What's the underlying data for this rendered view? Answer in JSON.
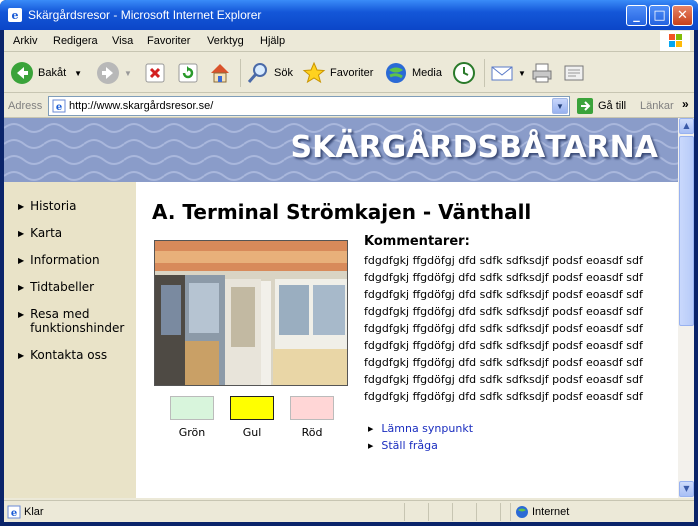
{
  "window": {
    "title": "Skärgårdsresor - Microsoft Internet Explorer"
  },
  "menu": [
    "Arkiv",
    "Redigera",
    "Visa",
    "Favoriter",
    "Verktyg",
    "Hjälp"
  ],
  "toolbar": {
    "back": "Bakåt",
    "search": "Sök",
    "favorites": "Favoriter",
    "media": "Media"
  },
  "address": {
    "label": "Adress",
    "url": "http://www.skargårdsresor.se/",
    "go": "Gå till",
    "links": "Länkar"
  },
  "site": {
    "banner": "SKÄRGÅRDSBÅTARNA",
    "nav": [
      "Historia",
      "Karta",
      "Information",
      "Tidtabeller",
      "Resa med funktionshinder",
      "Kontakta oss"
    ],
    "heading": "A. Terminal Strömkajen - Vänthall",
    "swatches": [
      {
        "label": "Grön",
        "color": "#d8f5dc"
      },
      {
        "label": "Gul",
        "color": "#ffff00"
      },
      {
        "label": "Röd",
        "color": "#ffd6d6"
      }
    ],
    "comments_title": "Kommentarer:",
    "comment_lines": [
      "fdgdfgkj ffgdöfgj dfd sdfk sdfksdjf podsf eoasdf sdf",
      "fdgdfgkj ffgdöfgj dfd sdfk sdfksdjf podsf eoasdf sdf",
      "fdgdfgkj ffgdöfgj dfd sdfk sdfksdjf podsf eoasdf sdf",
      "fdgdfgkj ffgdöfgj dfd sdfk sdfksdjf podsf eoasdf sdf",
      "fdgdfgkj ffgdöfgj dfd sdfk sdfksdjf podsf eoasdf sdf",
      "fdgdfgkj ffgdöfgj dfd sdfk sdfksdjf podsf eoasdf sdf",
      "fdgdfgkj ffgdöfgj dfd sdfk sdfksdjf podsf eoasdf sdf",
      "fdgdfgkj ffgdöfgj dfd sdfk sdfksdjf podsf eoasdf sdf",
      "fdgdfgkj ffgdöfgj dfd sdfk sdfksdjf podsf eoasdf sdf"
    ],
    "links": [
      "Lämna synpunkt",
      "Ställ fråga"
    ]
  },
  "status": {
    "text": "Klar",
    "zone": "Internet"
  }
}
